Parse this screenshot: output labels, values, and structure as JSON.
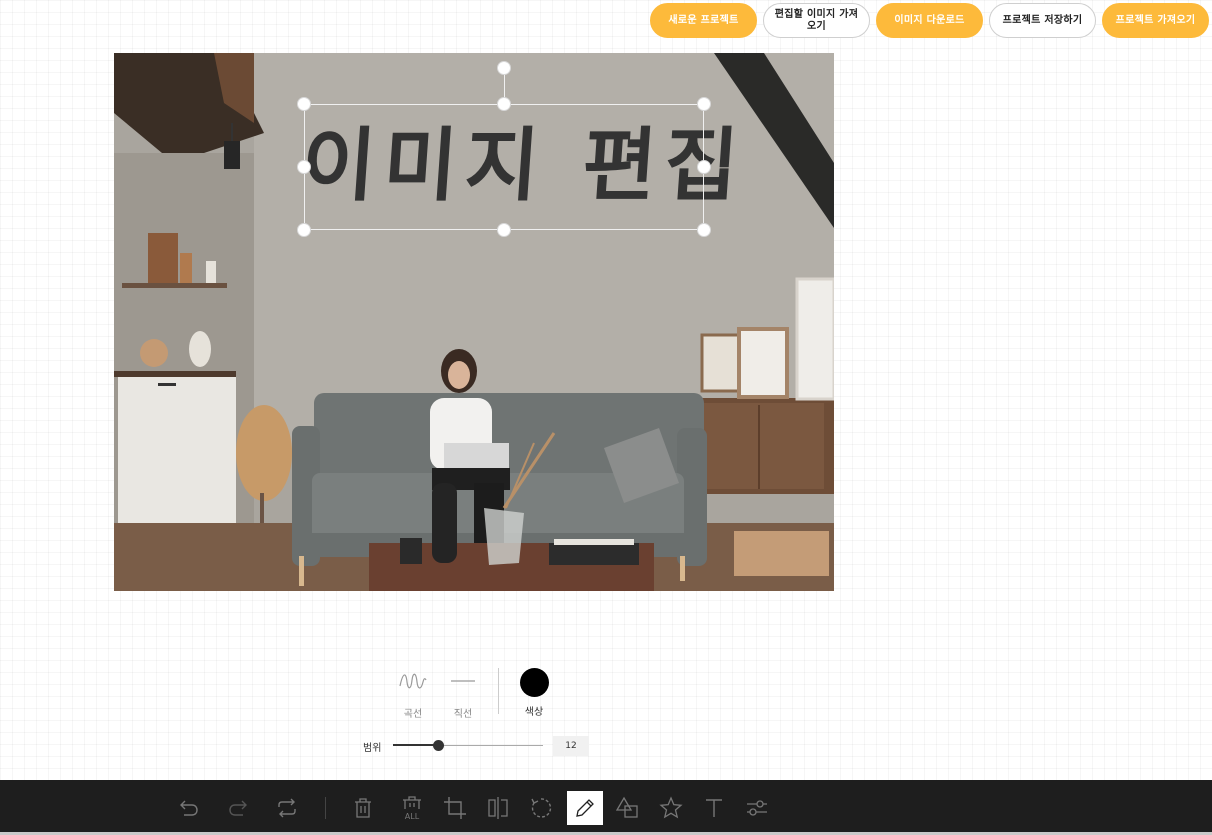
{
  "header": {
    "buttons": [
      {
        "label": "새로운 프로젝트",
        "style": "primary"
      },
      {
        "label": "편집할 이미지 가져오기",
        "style": "secondary"
      },
      {
        "label": "이미지 다운로드",
        "style": "primary"
      },
      {
        "label": "프로젝트 저장하기",
        "style": "secondary"
      },
      {
        "label": "프로젝트 가져오기",
        "style": "primary"
      }
    ]
  },
  "canvas": {
    "drawn_text": "이미지 편집",
    "image_icon": "living-room-photo"
  },
  "draw_menu": {
    "curve_label": "곡선",
    "straight_label": "직선",
    "color_label": "색상",
    "color_value": "#000000",
    "range_label": "범위",
    "range_value": "12",
    "range_fraction": 0.3
  },
  "toolbar": {
    "tools": [
      {
        "name": "undo-icon",
        "active": false
      },
      {
        "name": "redo-icon",
        "active": false
      },
      {
        "name": "reset-icon",
        "active": false
      },
      {
        "name": "delete-icon",
        "active": false
      },
      {
        "name": "delete-all-icon",
        "active": false,
        "text": "ALL"
      },
      {
        "name": "crop-icon",
        "active": false
      },
      {
        "name": "flip-icon",
        "active": false
      },
      {
        "name": "rotate-icon",
        "active": false
      },
      {
        "name": "draw-icon",
        "active": true
      },
      {
        "name": "shape-icon",
        "active": false
      },
      {
        "name": "icon-tool-icon",
        "active": false
      },
      {
        "name": "text-icon",
        "active": false
      },
      {
        "name": "filter-icon",
        "active": false
      }
    ]
  },
  "colors": {
    "accent": "#fdba3b",
    "toolbar_bg": "#1e1e1e"
  }
}
